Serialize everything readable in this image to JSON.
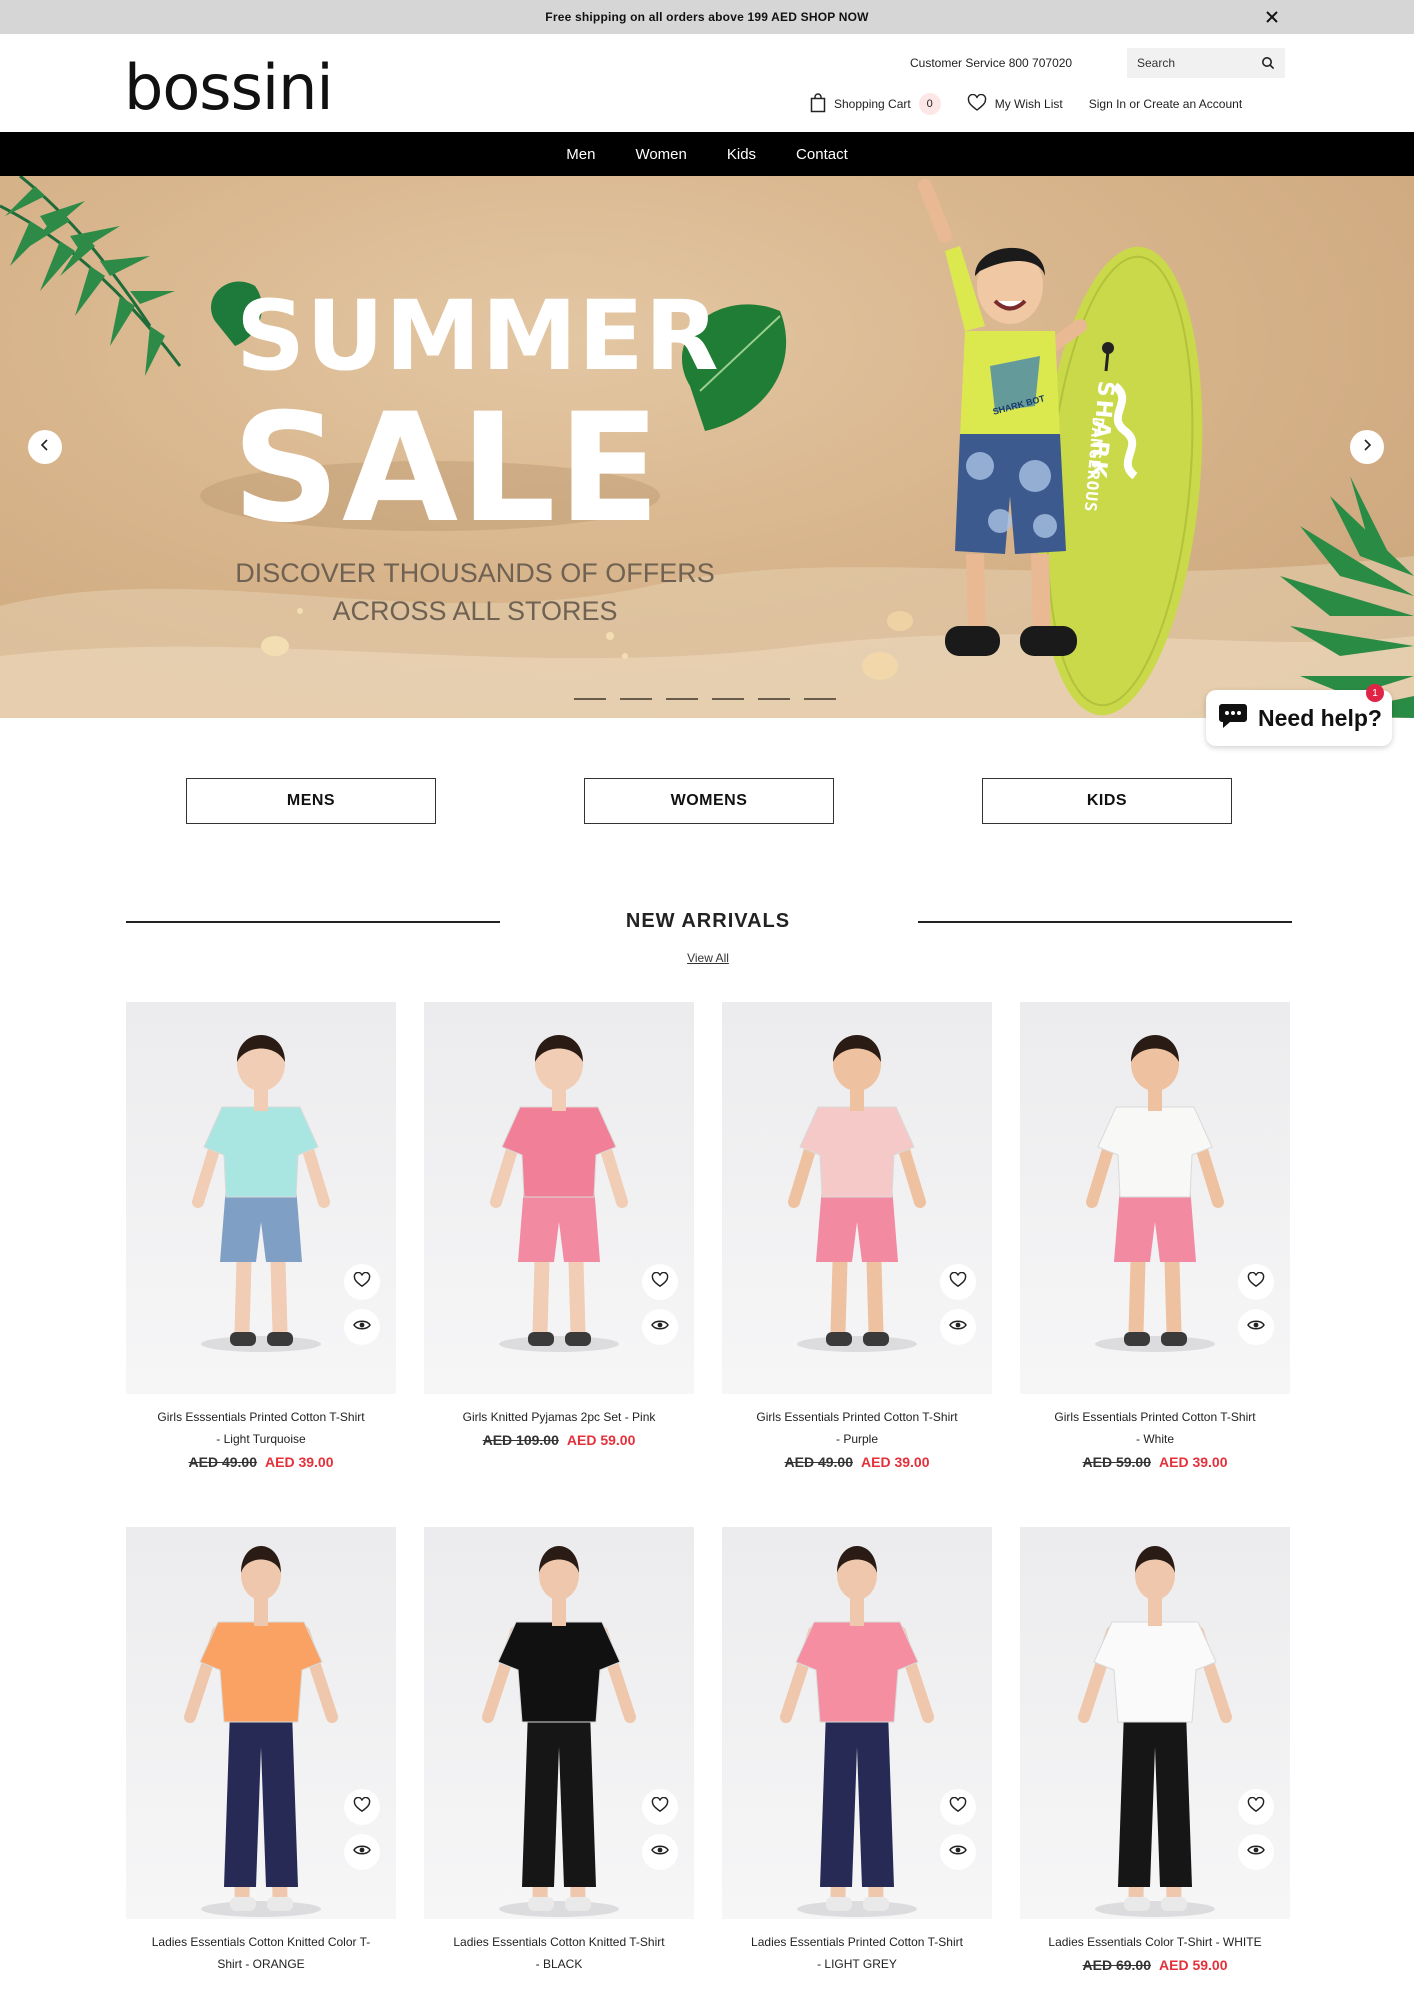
{
  "announcement": {
    "text": "Free shipping on all orders above 199 AED SHOP NOW",
    "close_icon": "close-icon"
  },
  "header": {
    "logo": "bossini",
    "customer_service": "Customer Service 800 707020",
    "search_placeholder": "Search",
    "cart_label": "Shopping Cart",
    "cart_count": "0",
    "wishlist_label": "My Wish List",
    "account_label": "Sign In or Create an Account"
  },
  "nav": {
    "items": [
      "Men",
      "Women",
      "Kids",
      "Contact"
    ]
  },
  "hero": {
    "title_line1": "SUMMER",
    "title_line2": "SALE",
    "subtitle_line1": "DISCOVER THOUSANDS OF OFFERS",
    "subtitle_line2": "ACROSS ALL STORES",
    "surfboard_text": "SHARK",
    "surfboard_text2": "DANGEROUS",
    "shirt_text": "SHARK BOT",
    "slide_count": 6,
    "colors": {
      "background": "#d8b58c",
      "surfboard": "#c9d94a"
    }
  },
  "help": {
    "label": "Need help?",
    "badge": "1"
  },
  "categories": [
    "MENS",
    "WOMENS",
    "KIDS"
  ],
  "new_arrivals": {
    "title": "NEW ARRIVALS",
    "view_all": "View All"
  },
  "products": [
    {
      "name1": "Girls Esssentials Printed Cotton T-Shirt",
      "name2": "- Light Turquoise",
      "old": "AED 49.00",
      "new": "AED 39.00",
      "top": "#a9e6e1",
      "bottom": "#7f9fc4",
      "skin": "#f0cdb4"
    },
    {
      "name1": "Girls Knitted Pyjamas 2pc Set - Pink",
      "name2": "",
      "old": "AED 109.00",
      "new": "AED 59.00",
      "top": "#f27f98",
      "bottom": "#f28aa2",
      "skin": "#f0cdb4"
    },
    {
      "name1": "Girls Essentials Printed Cotton T-Shirt",
      "name2": "- Purple",
      "old": "AED 49.00",
      "new": "AED 39.00",
      "top": "#f6c9c9",
      "bottom": "#f28aa2",
      "skin": "#eec2a0"
    },
    {
      "name1": "Girls Essentials Printed Cotton T-Shirt",
      "name2": "- White",
      "old": "AED 59.00",
      "new": "AED 39.00",
      "top": "#f8f8f6",
      "bottom": "#f28aa2",
      "skin": "#eec2a0"
    },
    {
      "name1": "Ladies Essentials Cotton Knitted Color T-",
      "name2": "Shirt - ORANGE",
      "old": "",
      "new": "",
      "top": "#f9a264",
      "bottom": "#262a55",
      "skin": "#efc7ac"
    },
    {
      "name1": "Ladies Essentials Cotton Knitted T-Shirt",
      "name2": "- BLACK",
      "old": "",
      "new": "",
      "top": "#111111",
      "bottom": "#161616",
      "skin": "#efc7ac"
    },
    {
      "name1": "Ladies Essentials Printed Cotton T-Shirt",
      "name2": "- LIGHT GREY",
      "old": "",
      "new": "",
      "top": "#f58ea0",
      "bottom": "#262a55",
      "skin": "#efc7ac"
    },
    {
      "name1": "Ladies Essentials Color T-Shirt - WHITE",
      "name2": "",
      "old": "AED 69.00",
      "new": "AED 59.00",
      "top": "#fafafa",
      "bottom": "#161616",
      "skin": "#efc7ac"
    }
  ]
}
